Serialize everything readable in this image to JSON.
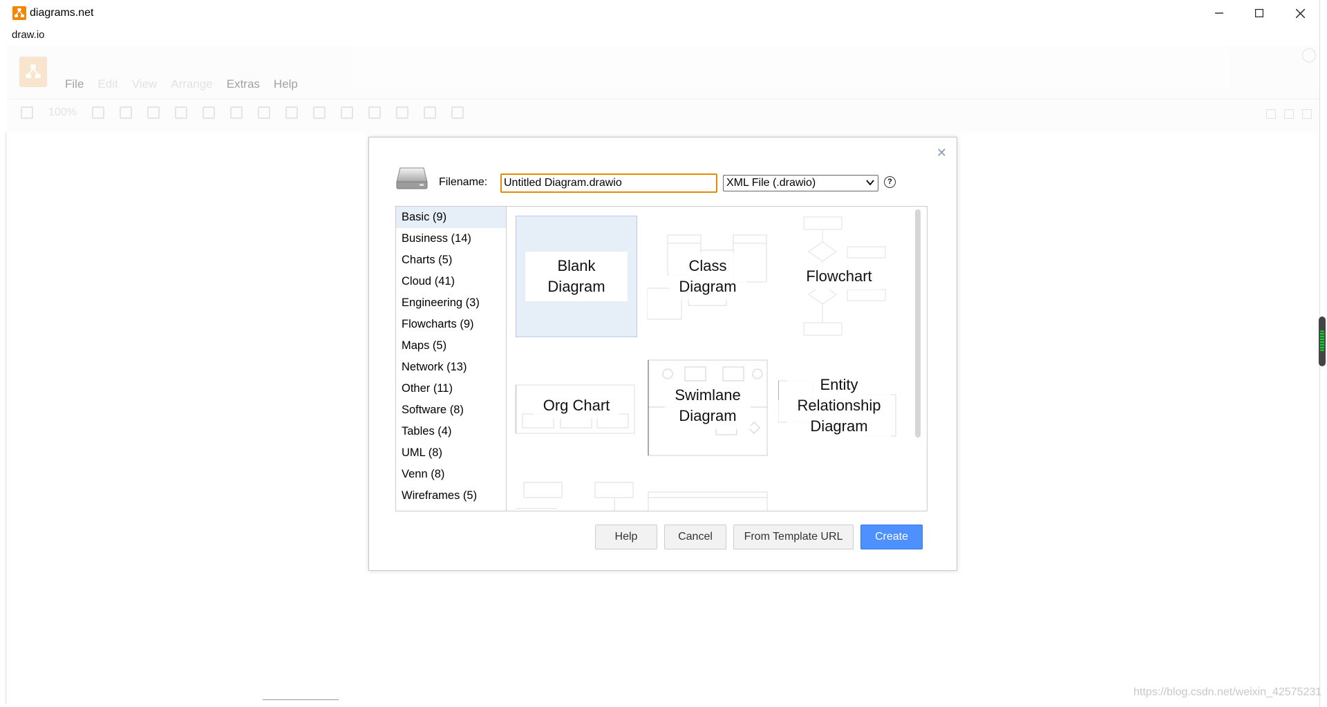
{
  "window": {
    "title": "diagrams.net",
    "subtitle": "draw.io"
  },
  "menu": {
    "items": [
      "File",
      "Edit",
      "View",
      "Arrange",
      "Extras",
      "Help"
    ],
    "zoom": "100%"
  },
  "dialog": {
    "filename_label": "Filename:",
    "filename_value": "Untitled Diagram.drawio",
    "format_selected": "XML File (.drawio)",
    "categories": [
      "Basic (9)",
      "Business (14)",
      "Charts (5)",
      "Cloud (41)",
      "Engineering (3)",
      "Flowcharts (9)",
      "Maps (5)",
      "Network (13)",
      "Other (11)",
      "Software (8)",
      "Tables (4)",
      "UML (8)",
      "Venn (8)",
      "Wireframes (5)"
    ],
    "selected_category": "Basic (9)",
    "templates": {
      "blank_1": "Blank",
      "blank_2": "Diagram",
      "class_1": "Class",
      "class_2": "Diagram",
      "flowchart": "Flowchart",
      "org": "Org Chart",
      "swim_1": "Swimlane",
      "swim_2": "Diagram",
      "er_1": "Entity",
      "er_2": "Relationship",
      "er_3": "Diagram"
    },
    "buttons": {
      "help": "Help",
      "cancel": "Cancel",
      "from_url": "From Template URL",
      "create": "Create"
    }
  },
  "watermark": "https://blog.csdn.net/weixin_42575231",
  "colors": {
    "accent": "#f08705",
    "primary_button": "#4d90fe",
    "selection": "#e6eef8",
    "input_focus": "#e68a00"
  }
}
